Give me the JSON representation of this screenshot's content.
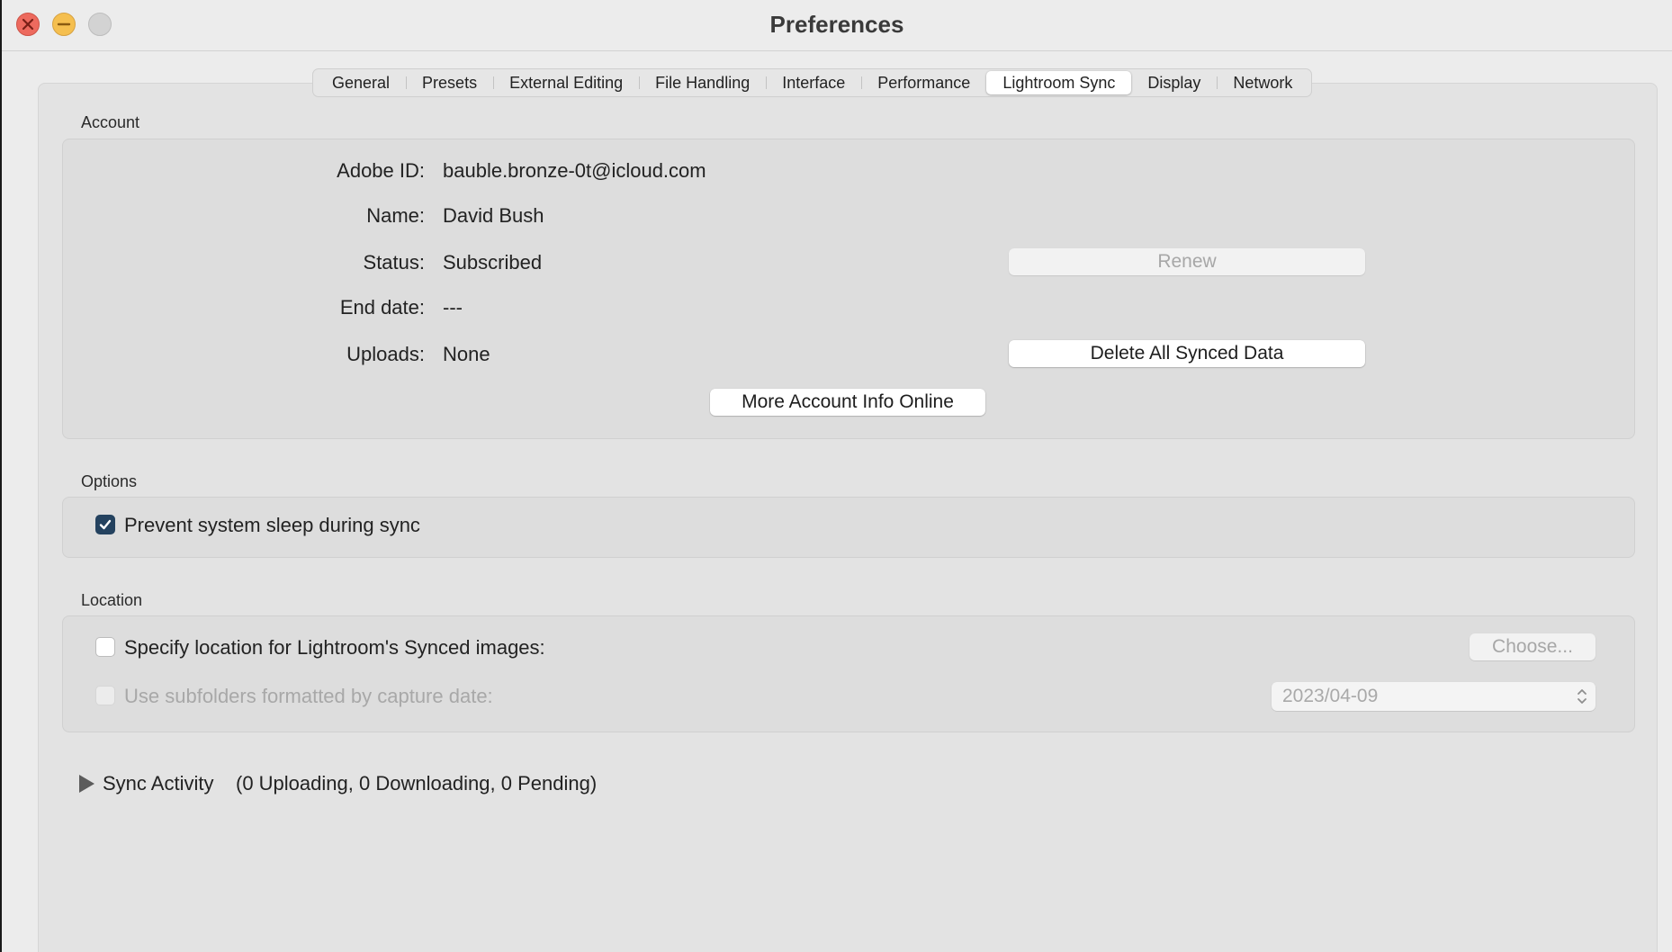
{
  "window": {
    "title": "Preferences"
  },
  "tabs": [
    {
      "label": "General"
    },
    {
      "label": "Presets"
    },
    {
      "label": "External Editing"
    },
    {
      "label": "File Handling"
    },
    {
      "label": "Interface"
    },
    {
      "label": "Performance"
    },
    {
      "label": "Lightroom Sync",
      "active": true
    },
    {
      "label": "Display"
    },
    {
      "label": "Network"
    }
  ],
  "account": {
    "section_label": "Account",
    "adobe_id_label": "Adobe ID:",
    "adobe_id": "bauble.bronze-0t@icloud.com",
    "name_label": "Name:",
    "name": "David Bush",
    "status_label": "Status:",
    "status": "Subscribed",
    "end_date_label": "End date:",
    "end_date": "---",
    "uploads_label": "Uploads:",
    "uploads": "None",
    "renew_button": "Renew",
    "delete_button": "Delete All Synced Data",
    "more_info_button": "More Account Info Online"
  },
  "options": {
    "section_label": "Options",
    "prevent_sleep_label": "Prevent system sleep during sync",
    "prevent_sleep_checked": true
  },
  "location": {
    "section_label": "Location",
    "specify_location_label": "Specify location for Lightroom's Synced images:",
    "specify_location_checked": false,
    "choose_button": "Choose...",
    "subfolders_label": "Use subfolders formatted by capture date:",
    "subfolders_checked": false,
    "date_format": "2023/04-09"
  },
  "sync_activity": {
    "label": "Sync Activity",
    "detail": "(0 Uploading, 0 Downloading, 0 Pending)"
  },
  "colors": {
    "checkbox_checked": "#24425f",
    "close": "#ed6a5e",
    "minimize": "#f5bf4f"
  },
  "icons": [
    "close-icon",
    "minimize-icon",
    "checkmark-icon",
    "disclosure-triangle-icon",
    "updown-chevron-icon"
  ]
}
